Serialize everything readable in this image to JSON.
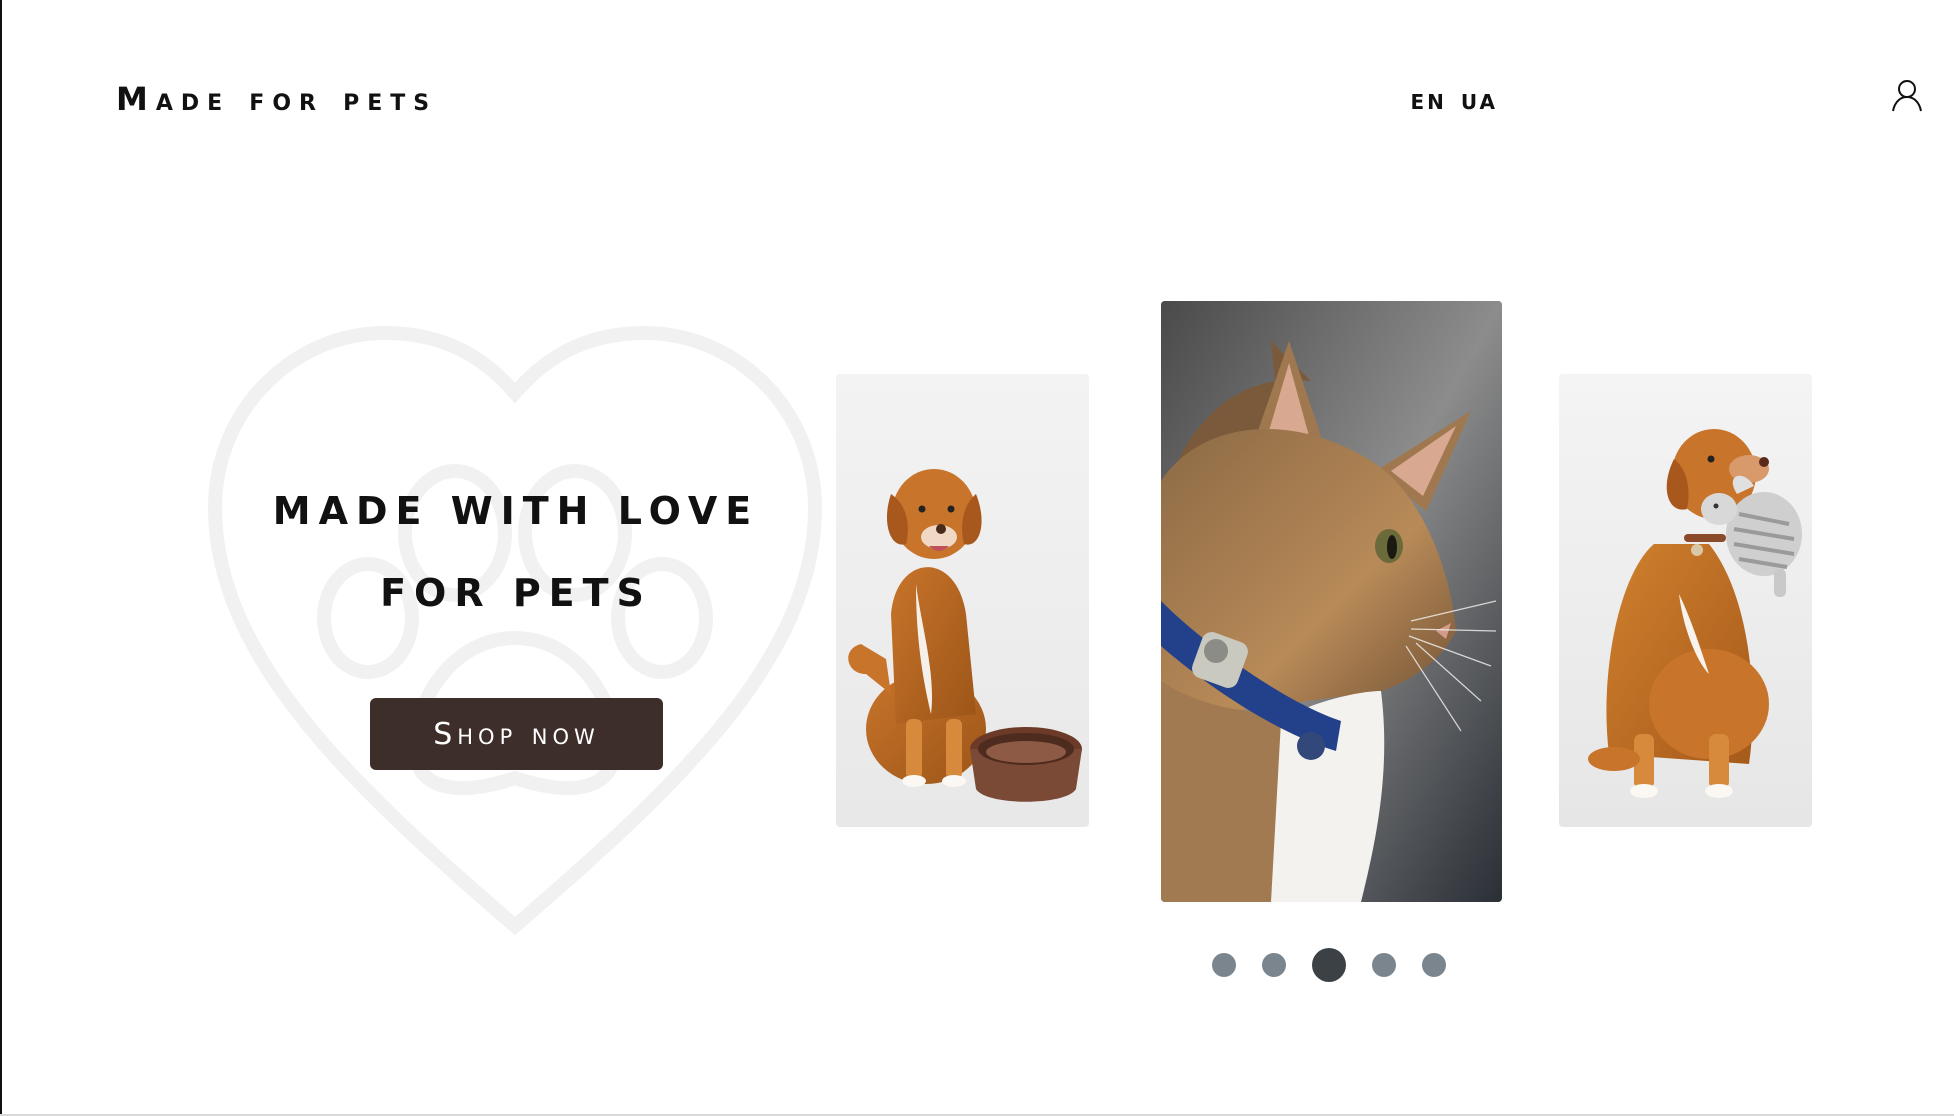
{
  "header": {
    "logo": "Made for pets",
    "languages": [
      "EN",
      "UA"
    ],
    "user_icon": "user-icon"
  },
  "hero": {
    "title_line1": "MADE WITH LOVE",
    "title_line2": "FOR PETS",
    "cta_label": "Shop now",
    "background_icon": "heart-paw-icon"
  },
  "carousel": {
    "slides": [
      {
        "subject": "dog-with-bowl"
      },
      {
        "subject": "cat-with-collar"
      },
      {
        "subject": "dog-with-toy"
      }
    ],
    "dot_count": 5,
    "active_dot": 3
  },
  "colors": {
    "button_bg": "#3d2e29",
    "dot_inactive": "#7b858e",
    "dot_active": "#3c4146",
    "watermark": "#f1f1f1"
  }
}
